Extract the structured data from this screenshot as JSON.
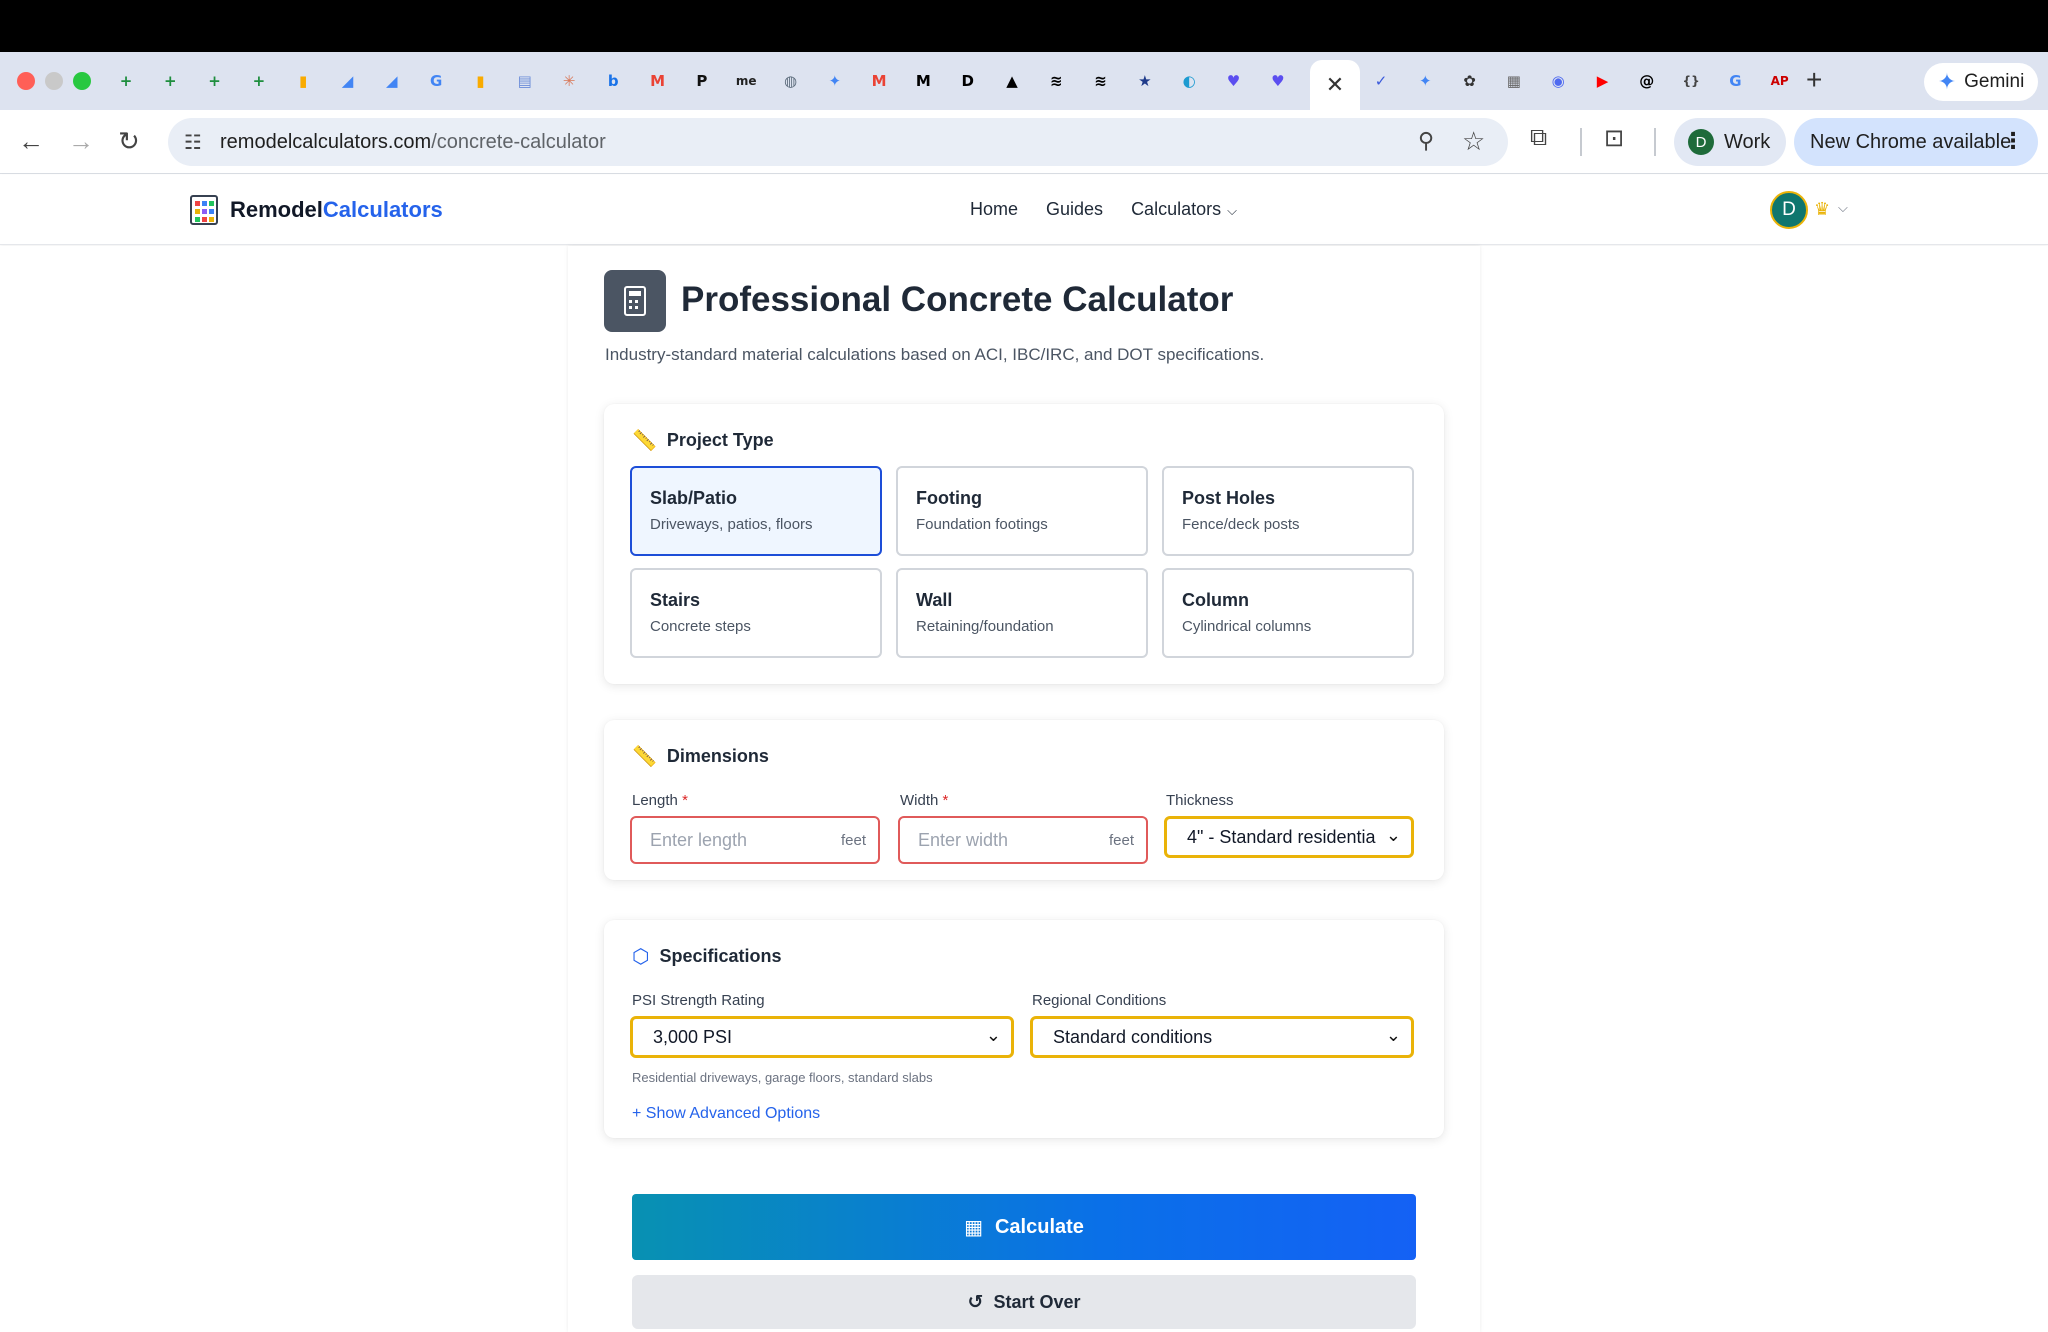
{
  "browser": {
    "tab_icons": [
      {
        "name": "sheets-icon",
        "glyph": "+",
        "color": "#1e8e3e"
      },
      {
        "name": "sheets-icon",
        "glyph": "+",
        "color": "#1e8e3e"
      },
      {
        "name": "sheets-icon",
        "glyph": "+",
        "color": "#1e8e3e"
      },
      {
        "name": "sheets-icon",
        "glyph": "+",
        "color": "#1e8e3e"
      },
      {
        "name": "analytics-icon",
        "glyph": "▮",
        "color": "#f9ab00"
      },
      {
        "name": "ads-icon",
        "glyph": "◢",
        "color": "#4285f4"
      },
      {
        "name": "ads-icon",
        "glyph": "◢",
        "color": "#4285f4"
      },
      {
        "name": "google-icon",
        "glyph": "G",
        "color": "#4285f4"
      },
      {
        "name": "analytics-icon",
        "glyph": "▮",
        "color": "#f9ab00"
      },
      {
        "name": "trash-icon",
        "glyph": "▤",
        "color": "#6b8cd8"
      },
      {
        "name": "claude-icon",
        "glyph": "✳",
        "color": "#d97757"
      },
      {
        "name": "bing-icon",
        "glyph": "b",
        "color": "#1a73e8"
      },
      {
        "name": "gmail-icon",
        "glyph": "M",
        "color": "#ea4335"
      },
      {
        "name": "p-icon",
        "glyph": "P",
        "color": "#111111"
      },
      {
        "name": "me-icon",
        "glyph": "me",
        "color": "#222222"
      },
      {
        "name": "globe-icon",
        "glyph": "◍",
        "color": "#5b6b7b"
      },
      {
        "name": "gemini-icon",
        "glyph": "✦",
        "color": "#4285f4"
      },
      {
        "name": "gmail-icon",
        "glyph": "M",
        "color": "#ea4335"
      },
      {
        "name": "medium-icon",
        "glyph": "M",
        "color": "#000000"
      },
      {
        "name": "dev-icon",
        "glyph": "D",
        "color": "#000000"
      },
      {
        "name": "triangle-icon",
        "glyph": "▲",
        "color": "#000000"
      },
      {
        "name": "capcut-icon",
        "glyph": "≋",
        "color": "#000000"
      },
      {
        "name": "capcut-icon",
        "glyph": "≋",
        "color": "#000000"
      },
      {
        "name": "shield-icon",
        "glyph": "★",
        "color": "#1e3a8a"
      },
      {
        "name": "edge-icon",
        "glyph": "◐",
        "color": "#1d9bd1"
      },
      {
        "name": "chat-heart-icon",
        "glyph": "♥",
        "color": "#5b4ef0"
      },
      {
        "name": "chat-heart-icon",
        "glyph": "♥",
        "color": "#5b4ef0"
      }
    ],
    "tab_icons_right": [
      {
        "name": "ai-icon",
        "glyph": "✓",
        "color": "#3b5bdb"
      },
      {
        "name": "gemini-icon",
        "glyph": "✦",
        "color": "#4285f4"
      },
      {
        "name": "openai-icon",
        "glyph": "✿",
        "color": "#333333"
      },
      {
        "name": "calc-icon",
        "glyph": "▦",
        "color": "#666666"
      },
      {
        "name": "circle-icon",
        "glyph": "◉",
        "color": "#4f6af0"
      },
      {
        "name": "youtube-icon",
        "glyph": "▶",
        "color": "#ff0000"
      },
      {
        "name": "threads-icon",
        "glyph": "@",
        "color": "#000000"
      },
      {
        "name": "braces-icon",
        "glyph": "{}",
        "color": "#444444"
      },
      {
        "name": "google-icon",
        "glyph": "G",
        "color": "#4285f4"
      },
      {
        "name": "ap-icon",
        "glyph": "AP",
        "color": "#cc0000"
      }
    ],
    "gemini_label": "Gemini",
    "url_host": "remodelcalculators.com",
    "url_path": "/concrete-calculator",
    "profile_label": "Work",
    "profile_initial": "D",
    "update_label": "New Chrome available"
  },
  "site": {
    "logo_part1": "Remodel",
    "logo_part2": "Calculators",
    "nav": {
      "home": "Home",
      "guides": "Guides",
      "calculators": "Calculators"
    },
    "user_initial": "D"
  },
  "page": {
    "title": "Professional Concrete Calculator",
    "subtitle": "Industry-standard material calculations based on ACI, IBC/IRC, and DOT specifications."
  },
  "project_type": {
    "heading": "Project Type",
    "options": [
      {
        "title": "Slab/Patio",
        "desc": "Driveways, patios, floors"
      },
      {
        "title": "Footing",
        "desc": "Foundation footings"
      },
      {
        "title": "Post Holes",
        "desc": "Fence/deck posts"
      },
      {
        "title": "Stairs",
        "desc": "Concrete steps"
      },
      {
        "title": "Wall",
        "desc": "Retaining/foundation"
      },
      {
        "title": "Column",
        "desc": "Cylindrical columns"
      }
    ]
  },
  "dimensions": {
    "heading": "Dimensions",
    "length_label": "Length",
    "length_placeholder": "Enter length",
    "width_label": "Width",
    "width_placeholder": "Enter width",
    "required_mark": "*",
    "unit": "feet",
    "thickness_label": "Thickness",
    "thickness_value": "4\" - Standard residentia"
  },
  "specifications": {
    "heading": "Specifications",
    "psi_label": "PSI Strength Rating",
    "psi_value": "3,000 PSI",
    "psi_hint": "Residential driveways, garage floors, standard slabs",
    "regional_label": "Regional Conditions",
    "regional_value": "Standard conditions",
    "advanced_link": "+ Show Advanced Options"
  },
  "actions": {
    "calculate": "Calculate",
    "start_over": "Start Over"
  }
}
